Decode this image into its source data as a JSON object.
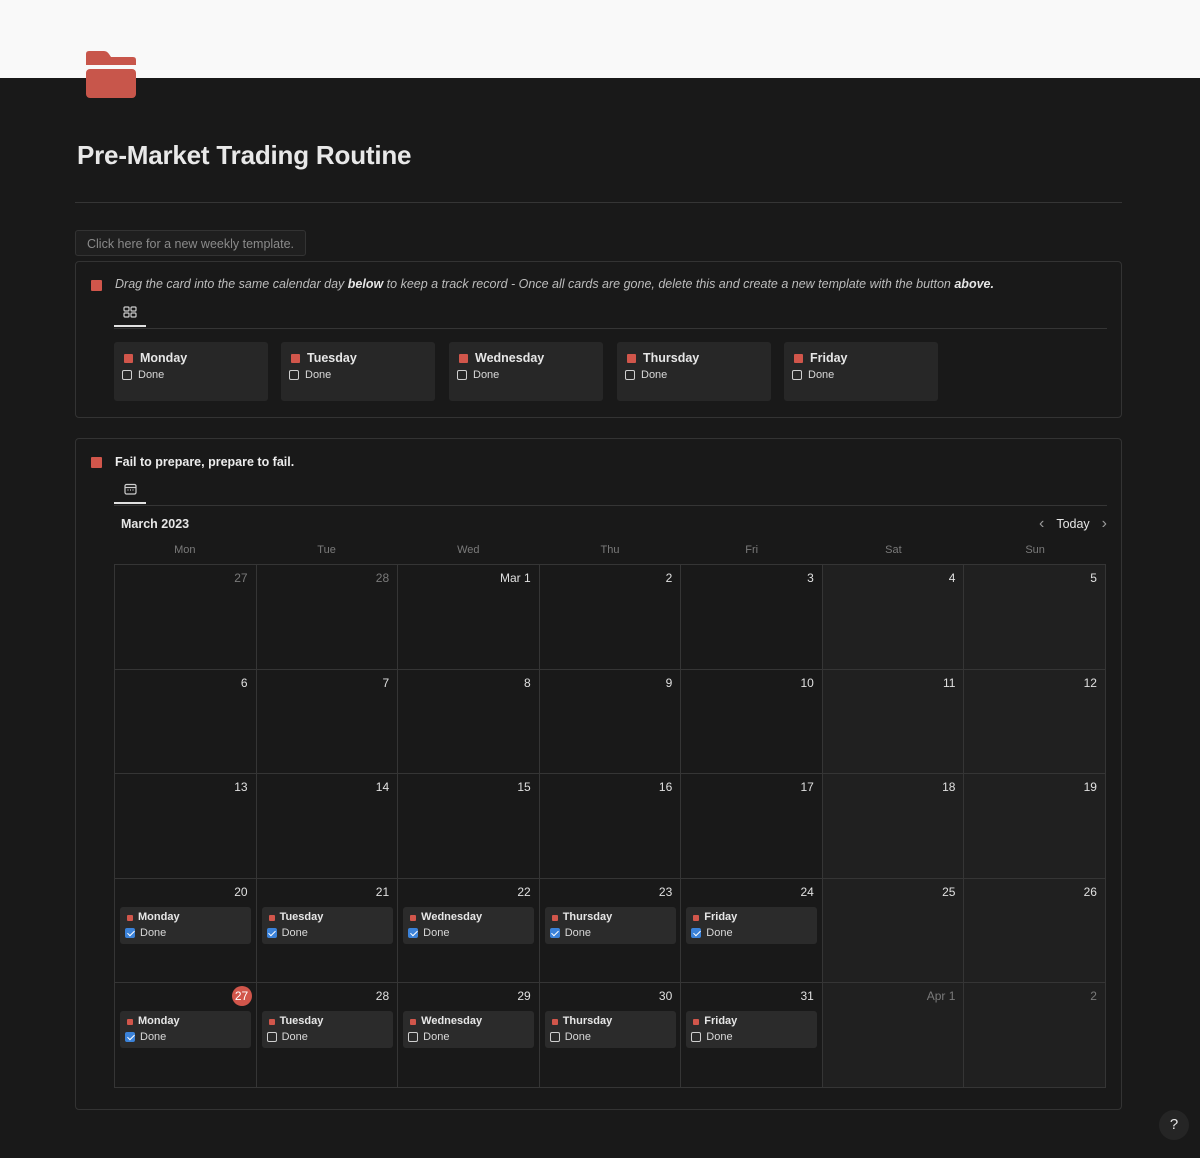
{
  "page": {
    "icon": "folder-icon",
    "title": "Pre-Market Trading Routine",
    "template_button": "Click here for a new weekly template."
  },
  "colors": {
    "accent": "#d1564b",
    "checkbox_checked": "#3b82d9",
    "background": "#191919",
    "card": "#272727"
  },
  "callout_a": {
    "text_1": "Drag the card into the same calendar day ",
    "text_bold_1": "below",
    "text_2": " to keep a track record - Once all cards are gone, delete this and create a new template with the button ",
    "text_bold_2": "above.",
    "view_icon": "gallery-icon",
    "cards": [
      {
        "title": "Monday",
        "done_label": "Done",
        "checked": false
      },
      {
        "title": "Tuesday",
        "done_label": "Done",
        "checked": false
      },
      {
        "title": "Wednesday",
        "done_label": "Done",
        "checked": false
      },
      {
        "title": "Thursday",
        "done_label": "Done",
        "checked": false
      },
      {
        "title": "Friday",
        "done_label": "Done",
        "checked": false
      }
    ]
  },
  "callout_b": {
    "title": "Fail to prepare, prepare to fail.",
    "view_icon": "calendar-icon",
    "month": "March 2023",
    "today_label": "Today",
    "weekdays": [
      "Mon",
      "Tue",
      "Wed",
      "Thu",
      "Fri",
      "Sat",
      "Sun"
    ],
    "days": [
      {
        "label": "27",
        "muted": true
      },
      {
        "label": "28",
        "muted": true
      },
      {
        "label": "Mar 1"
      },
      {
        "label": "2"
      },
      {
        "label": "3"
      },
      {
        "label": "4"
      },
      {
        "label": "5"
      },
      {
        "label": "6"
      },
      {
        "label": "7"
      },
      {
        "label": "8"
      },
      {
        "label": "9"
      },
      {
        "label": "10"
      },
      {
        "label": "11"
      },
      {
        "label": "12"
      },
      {
        "label": "13"
      },
      {
        "label": "14"
      },
      {
        "label": "15"
      },
      {
        "label": "16"
      },
      {
        "label": "17"
      },
      {
        "label": "18"
      },
      {
        "label": "19"
      },
      {
        "label": "20",
        "card": {
          "title": "Monday",
          "done_label": "Done",
          "checked": true
        }
      },
      {
        "label": "21",
        "card": {
          "title": "Tuesday",
          "done_label": "Done",
          "checked": true
        }
      },
      {
        "label": "22",
        "card": {
          "title": "Wednesday",
          "done_label": "Done",
          "checked": true
        }
      },
      {
        "label": "23",
        "card": {
          "title": "Thursday",
          "done_label": "Done",
          "checked": true
        }
      },
      {
        "label": "24",
        "card": {
          "title": "Friday",
          "done_label": "Done",
          "checked": true
        }
      },
      {
        "label": "25"
      },
      {
        "label": "26"
      },
      {
        "label": "27",
        "today": true,
        "card": {
          "title": "Monday",
          "done_label": "Done",
          "checked": true
        }
      },
      {
        "label": "28",
        "card": {
          "title": "Tuesday",
          "done_label": "Done",
          "checked": false
        }
      },
      {
        "label": "29",
        "card": {
          "title": "Wednesday",
          "done_label": "Done",
          "checked": false
        }
      },
      {
        "label": "30",
        "card": {
          "title": "Thursday",
          "done_label": "Done",
          "checked": false
        }
      },
      {
        "label": "31",
        "card": {
          "title": "Friday",
          "done_label": "Done",
          "checked": false
        }
      },
      {
        "label": "Apr 1",
        "muted": true
      },
      {
        "label": "2",
        "muted": true
      }
    ]
  },
  "help": {
    "label": "?"
  }
}
